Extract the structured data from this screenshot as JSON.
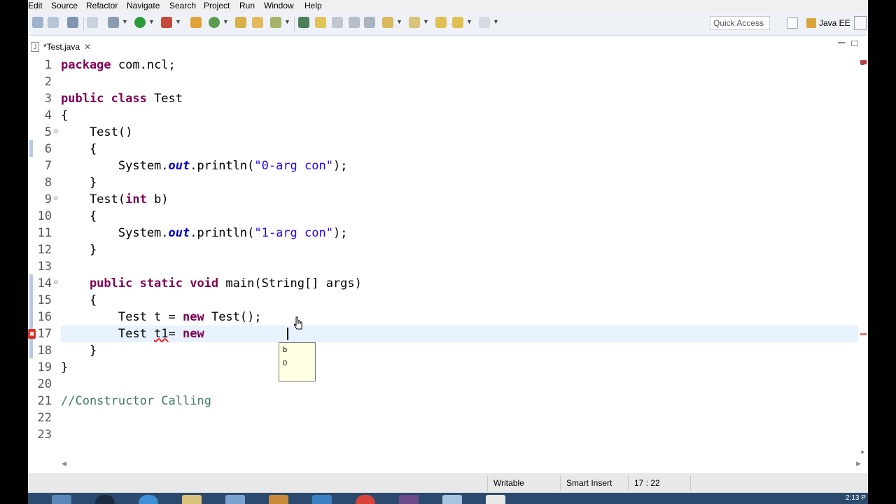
{
  "menu": [
    "Edit",
    "Source",
    "Refactor",
    "Navigate",
    "Search",
    "Project",
    "Run",
    "Window",
    "Help"
  ],
  "toolbar": {
    "quick_access_placeholder": "Quick Access",
    "perspective_label": "Java EE"
  },
  "editor_tab": {
    "title": "*Test.java",
    "close_glyph": "✕"
  },
  "code": {
    "lines": [
      {
        "n": "1"
      },
      {
        "n": "2"
      },
      {
        "n": "3"
      },
      {
        "n": "4"
      },
      {
        "n": "5"
      },
      {
        "n": "6"
      },
      {
        "n": "7"
      },
      {
        "n": "8"
      },
      {
        "n": "9"
      },
      {
        "n": "10"
      },
      {
        "n": "11"
      },
      {
        "n": "12"
      },
      {
        "n": "13"
      },
      {
        "n": "14"
      },
      {
        "n": "15"
      },
      {
        "n": "16"
      },
      {
        "n": "17"
      },
      {
        "n": "18"
      },
      {
        "n": "19"
      },
      {
        "n": "20"
      },
      {
        "n": "21"
      },
      {
        "n": "22"
      },
      {
        "n": "23"
      }
    ],
    "t": {
      "l1_kw": "package",
      "l1_rest": " com.ncl;",
      "l3_kw": "public class",
      "l3_rest": " Test",
      "l4": "{",
      "l5": "    Test()",
      "l6": "    {",
      "l7_a": "        System.",
      "l7_field": "out",
      "l7_b": ".println(",
      "l7_str": "\"0-arg con\"",
      "l7_c": ");",
      "l8": "    }",
      "l9_a": "    Test(",
      "l9_kw": "int",
      "l9_b": " b)",
      "l10": "    {",
      "l11_a": "        System.",
      "l11_field": "out",
      "l11_b": ".println(",
      "l11_str": "\"1-arg con\"",
      "l11_c": ");",
      "l12": "    }",
      "l14_kw": "    public static void",
      "l14_rest": " main(String[] args)",
      "l15": "    {",
      "l16_a": "        Test t = ",
      "l16_kw": "new",
      "l16_b": " Test();",
      "l17_a": "        Test ",
      "l17_err": "t1",
      "l17_b": "= ",
      "l17_kw": "new",
      "l18": "    }",
      "l19": "}",
      "l21": "//Constructor Calling"
    }
  },
  "popup": {
    "line1": "b",
    "line2": "0"
  },
  "error_marker": "✖",
  "statusbar": {
    "writable": "Writable",
    "insert_mode": "Smart Insert",
    "position": "17 : 22"
  },
  "taskbar": {
    "clock": "2:13 P"
  }
}
